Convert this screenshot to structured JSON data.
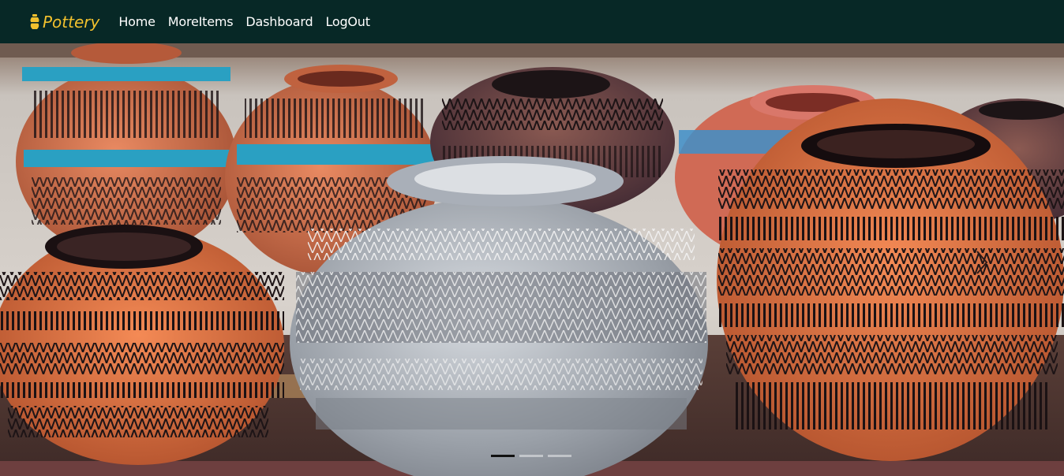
{
  "navbar": {
    "brand_label": "Pottery",
    "brand_icon": "vase-icon",
    "brand_color": "#f2c12e",
    "background": "#072826",
    "links": [
      {
        "label": "Home"
      },
      {
        "label": "MoreItems"
      },
      {
        "label": "Dashboard"
      },
      {
        "label": "LogOut"
      }
    ]
  },
  "carousel": {
    "slide_count": 3,
    "active_slide": 1,
    "next_icon": "chevron-right-icon"
  }
}
